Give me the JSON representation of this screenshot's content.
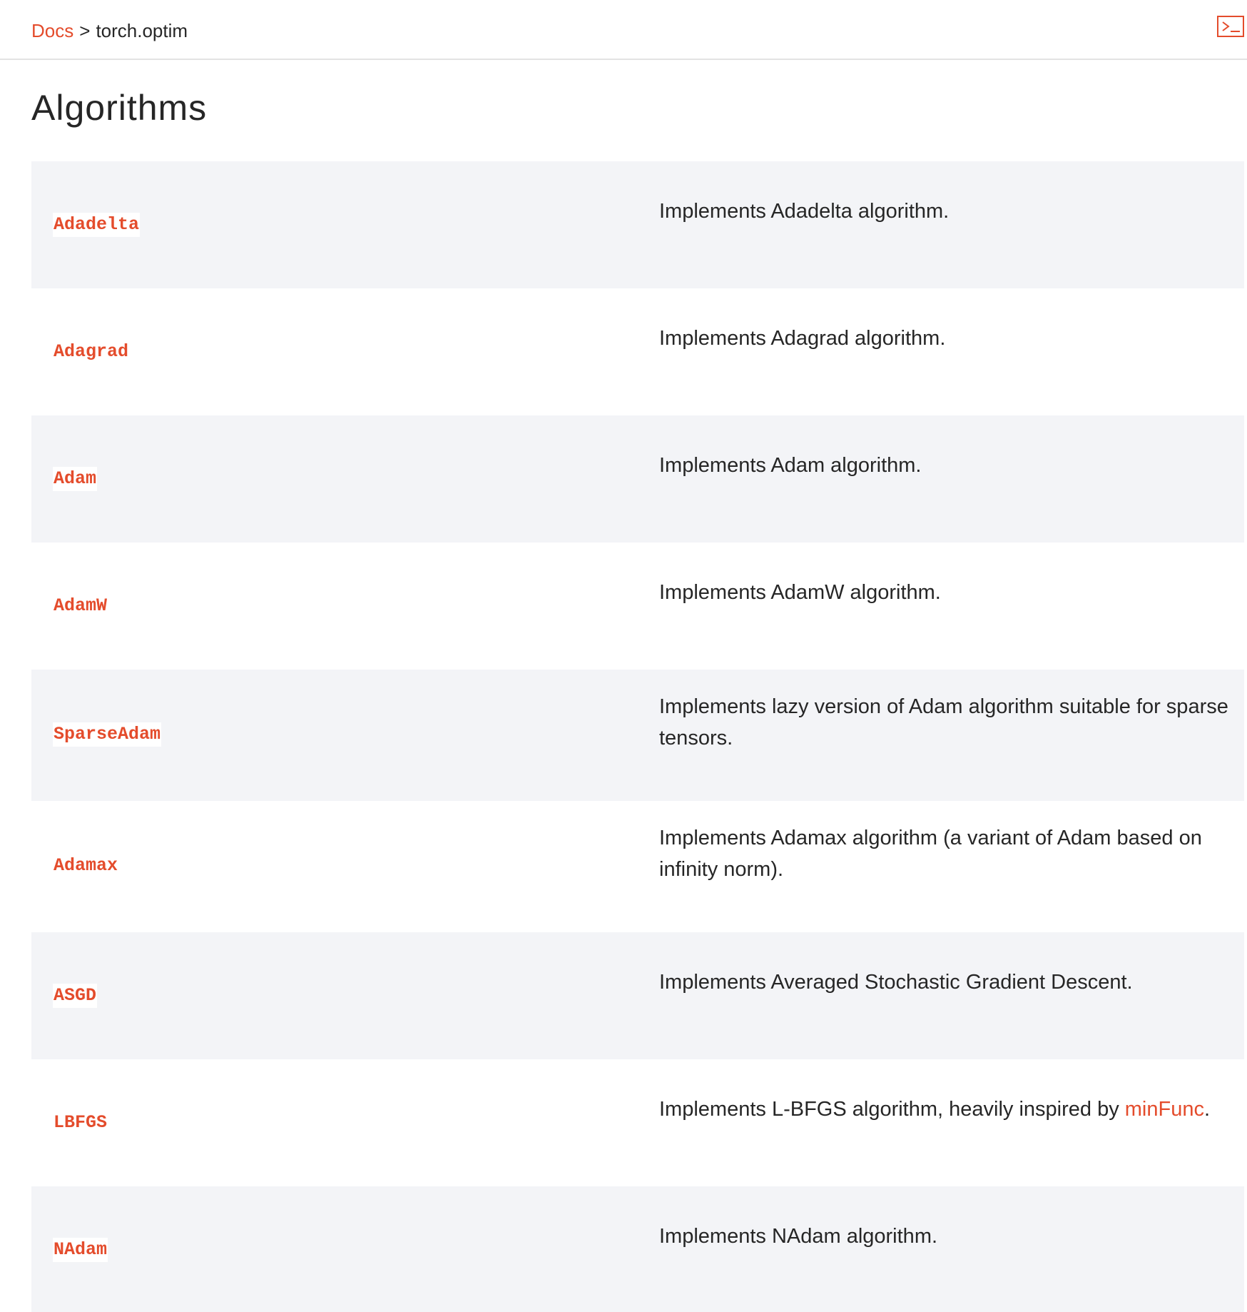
{
  "breadcrumb": {
    "root": "Docs",
    "separator": ">",
    "current": "torch.optim"
  },
  "header": {
    "shortcut_icon": "terminal-prompt-icon"
  },
  "page": {
    "title": "Algorithms"
  },
  "algorithms": [
    {
      "name": "Adadelta",
      "desc": "Implements Adadelta algorithm."
    },
    {
      "name": "Adagrad",
      "desc": "Implements Adagrad algorithm."
    },
    {
      "name": "Adam",
      "desc": "Implements Adam algorithm."
    },
    {
      "name": "AdamW",
      "desc": "Implements AdamW algorithm."
    },
    {
      "name": "SparseAdam",
      "desc": "Implements lazy version of Adam algorithm suitable for sparse tensors."
    },
    {
      "name": "Adamax",
      "desc": "Implements Adamax algorithm (a variant of Adam based on infinity norm)."
    },
    {
      "name": "ASGD",
      "desc": "Implements Averaged Stochastic Gradient Descent."
    },
    {
      "name": "LBFGS",
      "desc_prefix": "Implements L-BFGS algorithm, heavily inspired by ",
      "desc_link": "minFunc",
      "desc_suffix": "."
    },
    {
      "name": "NAdam",
      "desc": "Implements NAdam algorithm."
    }
  ],
  "colors": {
    "accent": "#e44c2c",
    "row_alt": "#f3f4f7",
    "text": "#262626"
  }
}
